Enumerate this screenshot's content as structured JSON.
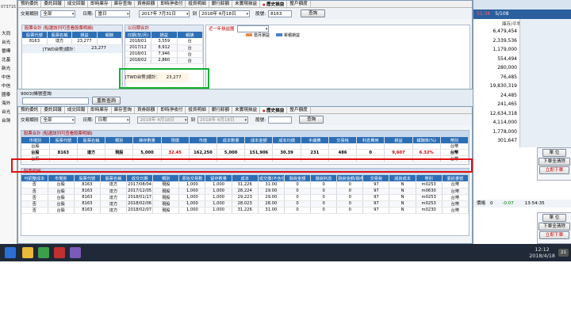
{
  "top_window": {
    "tabs": [
      "預約委託",
      "委託回報",
      "成交回報",
      "即時庫存",
      "庫存查詢",
      "資券餘額",
      "即時淨收付",
      "投資明細",
      "銀行餘額",
      "未實現損益",
      "歷史損益",
      "整戶額度"
    ],
    "active_tab": 10,
    "filter": {
      "type_label": "交易類別",
      "type_value": "全部",
      "date_label": "日期:",
      "date_mode": "當日",
      "date_from": "2017年 7月31日",
      "to_label": "到",
      "date_to": "2018年 4月18日",
      "stock_label": "股號:",
      "stock_value": "8163",
      "query_button": "查詢"
    },
    "panel_stock": {
      "title": "股票合計 (點選該列可查看股票明細)",
      "headers": [
        "股票代號",
        "股票名稱",
        "損益",
        "報酬"
      ],
      "rows": [
        [
          "8163",
          "達方",
          "23,277",
          ""
        ]
      ],
      "total_label": "[TWD台幣]總計：",
      "total_value": "23,277"
    },
    "panel_date": {
      "title": "以日期合計",
      "headers": [
        "日期(年/月)",
        "損益",
        "報酬"
      ],
      "rows": [
        [
          "2018/01",
          "3,559",
          "台"
        ],
        [
          "2017/12",
          "8,912",
          "台"
        ],
        [
          "2018/01",
          "7,946",
          "台"
        ],
        [
          "2018/02",
          "2,860",
          "台"
        ]
      ],
      "total_label": "[TWD台幣]總計：",
      "total_value": "23,277"
    },
    "panel_year": {
      "title": "近一年損益圖",
      "legend": [
        "當月損益",
        "累積損益"
      ]
    }
  },
  "middle": {
    "caption": "9003)帳號查詢",
    "refresh_button": "重新查詢"
  },
  "bottom_window": {
    "tabs": [
      "預約委託",
      "委託回報",
      "成交回報",
      "即時庫存",
      "庫存查詢",
      "資券餘額",
      "即時淨收付",
      "投資明細",
      "銀行餘額",
      "未實現損益",
      "歷史損益",
      "整戶額度"
    ],
    "active_tab": 10,
    "filter": {
      "type_label": "交易類別",
      "type_value": "全部",
      "date_label": "日期:",
      "date_mode": "日期",
      "date_from": "2018年 4月18日",
      "to_label": "到",
      "date_to": "2018年 4月18日",
      "stock_label": "股號:",
      "stock_value": "",
      "query_button": "查詢"
    },
    "summary": {
      "title": "股票合計 (點選該列可查看股票明細)",
      "headers": [
        "市場別",
        "股票代號",
        "股票名稱",
        "類別",
        "庫存數量",
        "現價",
        "市值",
        "成本數量",
        "成本金額",
        "成本均價",
        "手續費",
        "交易稅",
        "利息費用",
        "損益",
        "報酬率(%)",
        "幣別"
      ],
      "partial_above": [
        "台股",
        "",
        "",
        "",
        "",
        "",
        "",
        "",
        "",
        "",
        "",
        "",
        "",
        "",
        "",
        "台幣"
      ],
      "highlight": [
        "台股",
        "8163",
        "達方",
        "現股",
        "5,000",
        "32.45",
        "162,250",
        "5,000",
        "151,906",
        "30.39",
        "231",
        "486",
        "0",
        "9,607",
        "6.32%",
        "台幣"
      ],
      "partial_below": [
        "台股",
        "",
        "",
        "",
        "",
        "",
        "",
        "",
        "",
        "",
        "",
        "",
        "",
        "",
        "",
        "台幣"
      ]
    },
    "detail": {
      "title": "股票明細",
      "headers": [
        "可調整成本",
        "市場別",
        "股票代號",
        "股票名稱",
        "成交日期",
        "類別",
        "原始交易數",
        "留存數量",
        "成本",
        "成交價(不含任何費用)",
        "融資金額",
        "融資利息",
        "融資金額/融券擔保品",
        "交易稅",
        "減資成本",
        "幣別",
        "委託書號"
      ],
      "rows": [
        [
          "否",
          "台股",
          "8163",
          "達方",
          "2017/08/04",
          "現股",
          "1,000",
          "1,000",
          "31,226",
          "31.00",
          "0",
          "0",
          "0",
          "97",
          "N",
          "m0253",
          "台幣"
        ],
        [
          "否",
          "台股",
          "8163",
          "達方",
          "2017/12/05",
          "現股",
          "1,000",
          "1,000",
          "28,224",
          "29.00",
          "0",
          "0",
          "0",
          "97",
          "N",
          "m0630",
          "台幣"
        ],
        [
          "否",
          "台股",
          "8163",
          "達方",
          "2018/01/17",
          "現股",
          "1,000",
          "1,000",
          "29,223",
          "29.00",
          "0",
          "0",
          "0",
          "97",
          "N",
          "m0253",
          "台幣"
        ],
        [
          "否",
          "台股",
          "8163",
          "達方",
          "2018/02/06",
          "現股",
          "1,000",
          "1,000",
          "28,023",
          "28.00",
          "0",
          "0",
          "0",
          "97",
          "N",
          "m0253",
          "台幣"
        ],
        [
          "否",
          "台股",
          "8163",
          "達方",
          "2018/02/07",
          "現股",
          "1,000",
          "1,000",
          "31,226",
          "31.00",
          "0",
          "0",
          "0",
          "97",
          "N",
          "m0230",
          "台幣"
        ]
      ]
    }
  },
  "right_panel": {
    "header_time": "51:36",
    "header_count": "5/108",
    "header_label": "庫存/平零值",
    "values": [
      "6,479,454",
      "2,339,536",
      "1,179,000",
      "554,494",
      "280,000",
      "76,485",
      "19,830,319",
      "24,485",
      "241,465",
      "12,634,318",
      "4,114,000",
      "1,778,000",
      "301,647"
    ],
    "lower_labels": [
      "單 位",
      "下單全清除",
      "立即下單"
    ],
    "quote": {
      "label": "價格",
      "value": "0",
      "change": "-0.07",
      "time": "13:54:35"
    },
    "lower_labels2": [
      "單 位",
      "下單全清除",
      "立即下單"
    ]
  },
  "left_edge": {
    "top_number": "073715",
    "labels": [
      "大同",
      "台光",
      "晉樺",
      "北基",
      "新光",
      "中信",
      "中信",
      "國泰",
      "海外",
      "台光",
      "台灣"
    ]
  },
  "taskbar": {
    "time": "12:12",
    "date": "2018/4/18",
    "badge": "21"
  },
  "colors": {
    "accent": "#2d6fb5",
    "highlight_box": "#e01010",
    "total_box": "#10b030",
    "profit": "#d00000"
  }
}
